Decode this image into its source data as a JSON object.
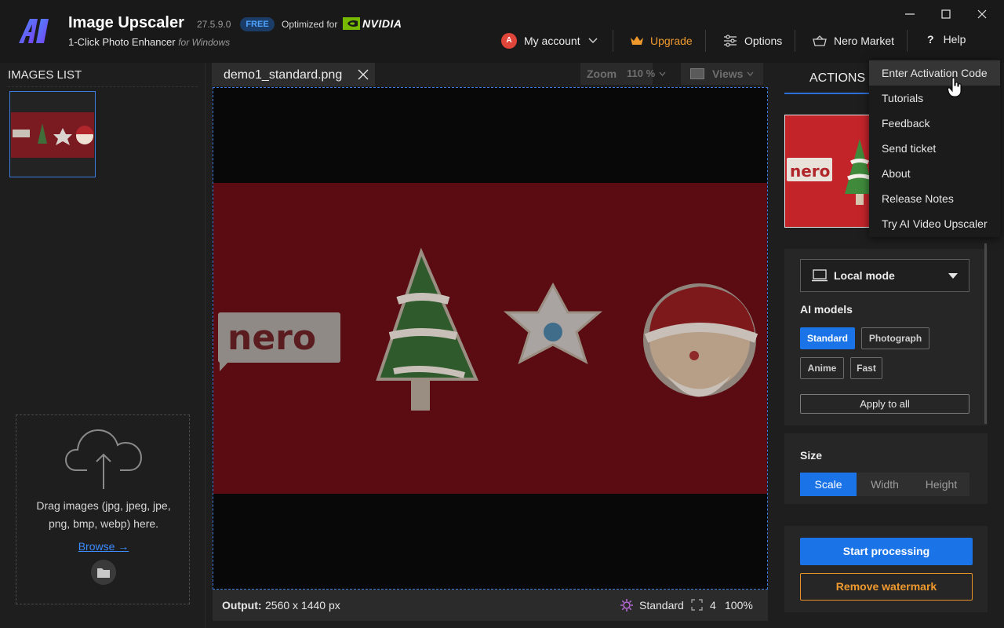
{
  "header": {
    "app_title": "Image Upscaler",
    "version": "27.5.9.0",
    "badge": "FREE",
    "optimized_label": "Optimized for",
    "nvidia_label": "NVIDIA",
    "subtitle": "1-Click Photo Enhancer",
    "subtitle_platform": "for Windows",
    "logo_text": "AI"
  },
  "nav": {
    "avatar_initial": "A",
    "my_account": "My account",
    "upgrade": "Upgrade",
    "options": "Options",
    "nero_market": "Nero Market",
    "help": "Help"
  },
  "left_panel": {
    "title": "IMAGES LIST",
    "drop_text_line1": "Drag images (jpg, jpeg, jpe,",
    "drop_text_line2": "png, bmp, webp) here.",
    "browse": "Browse →"
  },
  "center": {
    "file_tab": "demo1_standard.png",
    "zoom_label": "Zoom",
    "zoom_value": "110 %",
    "views_label": "Views",
    "image_brand_text": "nero"
  },
  "status": {
    "output_label": "Output:",
    "output_value": "2560 x 1440 px",
    "model": "Standard",
    "scale": "4",
    "quality": "100%"
  },
  "right_panel": {
    "actions_tab": "ACTIONS",
    "mode": "Local mode",
    "ai_models_label": "AI models",
    "models": [
      "Standard",
      "Photograph",
      "Anime",
      "Fast"
    ],
    "active_model": "Standard",
    "apply_all": "Apply to all",
    "size_label": "Size",
    "size_tabs": [
      "Scale",
      "Width",
      "Height"
    ],
    "active_size_tab": "Scale",
    "start_processing": "Start processing",
    "remove_watermark": "Remove watermark"
  },
  "help_menu": {
    "items": [
      "Enter Activation Code",
      "Tutorials",
      "Feedback",
      "Send ticket",
      "About",
      "Release Notes",
      "Try AI Video Upscaler"
    ],
    "hovered": "Enter Activation Code"
  },
  "colors": {
    "accent_blue": "#1a74e8",
    "upgrade_orange": "#f09a2e",
    "nvidia_green": "#76b900",
    "photo_red": "#5a0c12"
  }
}
